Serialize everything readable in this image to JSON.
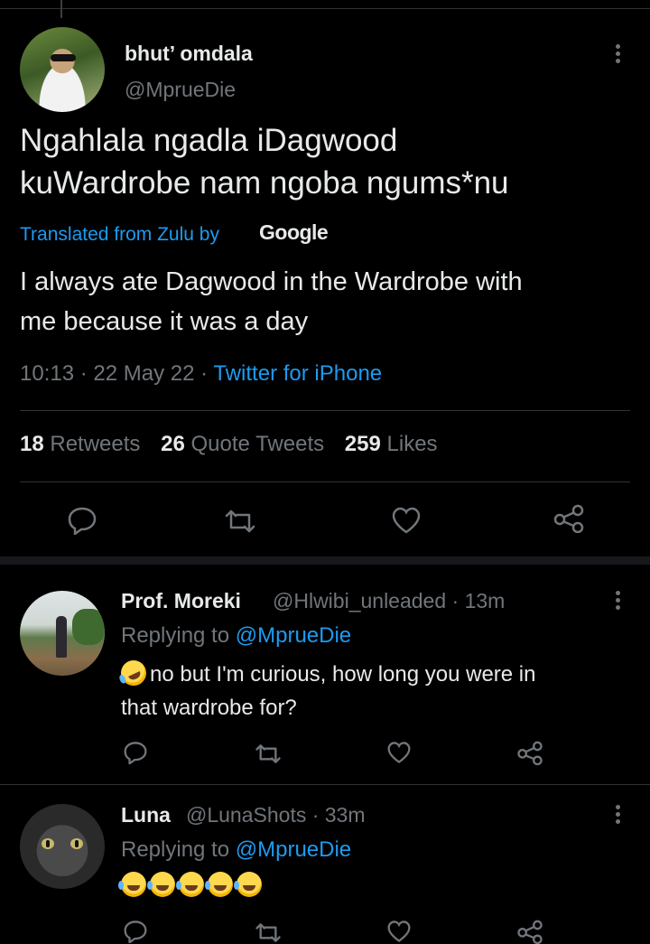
{
  "main_tweet": {
    "author_name": "bhut’ omdala",
    "author_handle": "@MprueDie",
    "text_line1": "Ngahlala ngadla iDagwood",
    "text_line2": "kuWardrobe nam ngoba ngums*nu",
    "translated_label": "Translated from Zulu by",
    "translator": "Google",
    "translation_line1": "I always ate Dagwood in the Wardrobe with",
    "translation_line2": "me because it was a day",
    "time": "10:13",
    "date": "22 May 22",
    "source": "Twitter for iPhone",
    "retweets_count": "18",
    "retweets_label": "Retweets",
    "quotes_count": "26",
    "quotes_label": "Quote Tweets",
    "likes_count": "259",
    "likes_label": "Likes"
  },
  "replies": [
    {
      "name": "Prof. Moreki",
      "handle_time": "@Hlwibi_unleaded · 13m",
      "replying_prefix": "Replying to",
      "replying_to": "@MprueDie",
      "text_line1": "no but I'm curious, how long you were in",
      "text_line2": "that wardrobe for?",
      "emoji": "rolling-on-floor-laughing"
    },
    {
      "name": "Luna",
      "handle_time": "@LunaShots · 33m",
      "replying_prefix": "Replying to",
      "replying_to": "@MprueDie",
      "emoji": "face-with-tears-of-joy x5"
    }
  ],
  "colors": {
    "background": "#000000",
    "text": "#e7e9ea",
    "muted": "#71767b",
    "link": "#1d9bf0",
    "divider": "#2f3336"
  }
}
